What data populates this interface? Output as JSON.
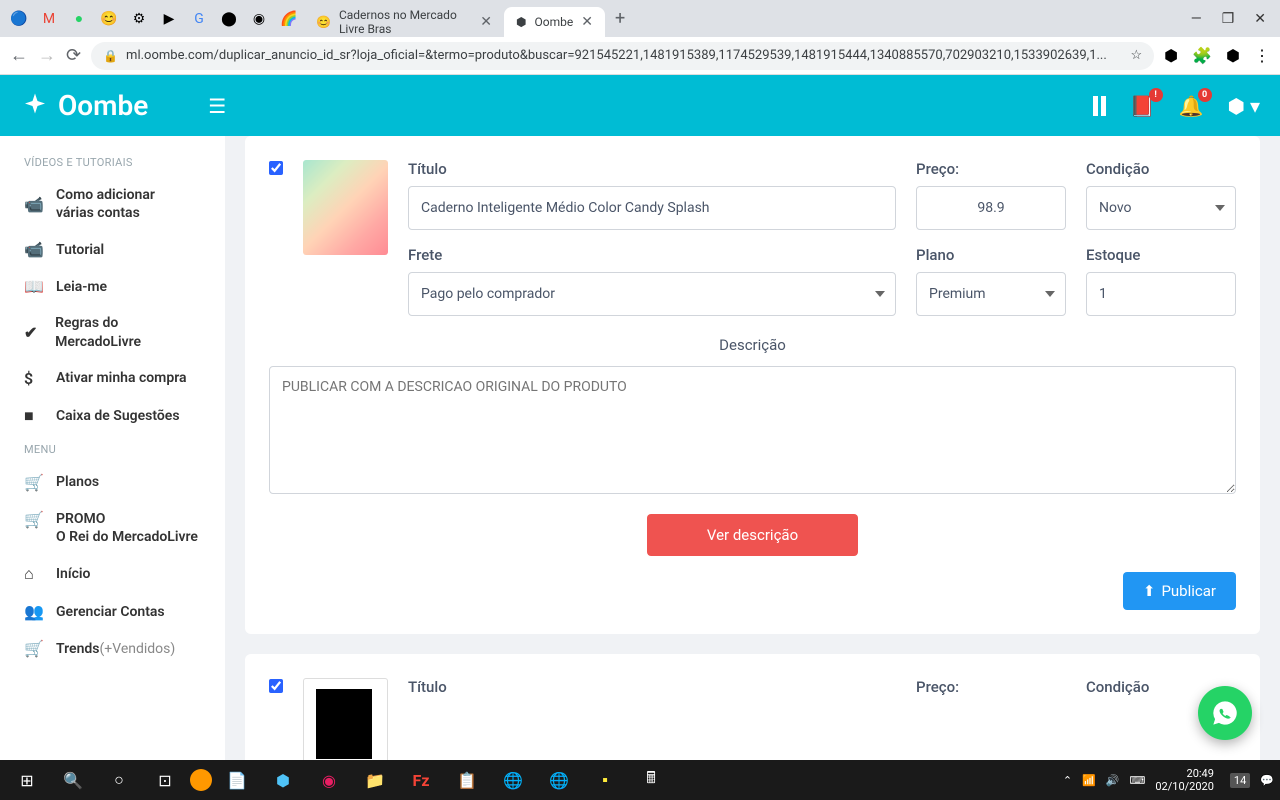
{
  "browser": {
    "tabs": [
      {
        "title": "Cadernos no Mercado Livre Bras",
        "icon": "😊"
      },
      {
        "title": "Oombe",
        "icon": "⬢"
      }
    ],
    "url": "ml.oombe.com/duplicar_anuncio_id_sr?loja_oficial=&termo=produto&buscar=921545221,1481915389,1174529539,1481915444,1340885570,702903210,1533902639,1...",
    "window_controls": {
      "min": "—",
      "max": "❐",
      "close": "✕"
    }
  },
  "app": {
    "brand": "Oombe",
    "topbar_badges": {
      "book": "!",
      "bell": "0"
    }
  },
  "sidebar": {
    "section1_title": "VÍDEOS e TUTORIAIS",
    "items1": [
      {
        "icon": "📹",
        "label": "Como adicionar\nvárias contas"
      },
      {
        "icon": "📹",
        "label": "Tutorial"
      },
      {
        "icon": "📖",
        "label": "Leia-me"
      },
      {
        "icon": "✔",
        "label": "Regras do MercadoLivre"
      },
      {
        "icon": "$",
        "label": "Ativar minha compra"
      },
      {
        "icon": "■",
        "label": "Caixa de Sugestões"
      }
    ],
    "section2_title": "MENU",
    "items2": [
      {
        "icon": "🛒",
        "label": "Planos"
      },
      {
        "icon": "🛒",
        "label": "PROMO",
        "label2": "O Rei do MercadoLivre"
      },
      {
        "icon": "⌂",
        "label": "Início"
      },
      {
        "icon": "👥",
        "label": "Gerenciar Contas"
      },
      {
        "icon": "🛒",
        "label": "Trends",
        "sublabel": "(+Vendidos)"
      }
    ]
  },
  "product1": {
    "labels": {
      "titulo": "Título",
      "preco": "Preço:",
      "condicao": "Condição",
      "frete": "Frete",
      "plano": "Plano",
      "estoque": "Estoque",
      "descricao": "Descrição"
    },
    "titulo": "Caderno Inteligente Médio Color Candy Splash",
    "preco": "98.9",
    "condicao": "Novo",
    "frete": "Pago pelo comprador",
    "plano": "Premium",
    "estoque": "1",
    "descricao_placeholder": "PUBLICAR COM A DESCRICAO ORIGINAL DO PRODUTO",
    "btn_ver": "Ver descrição",
    "btn_publicar": "Publicar"
  },
  "product2": {
    "labels": {
      "titulo": "Título",
      "preco": "Preço:",
      "condicao": "Condição"
    }
  },
  "taskbar": {
    "clock_time": "20:49",
    "clock_date": "02/10/2020",
    "notif_count": "14"
  }
}
